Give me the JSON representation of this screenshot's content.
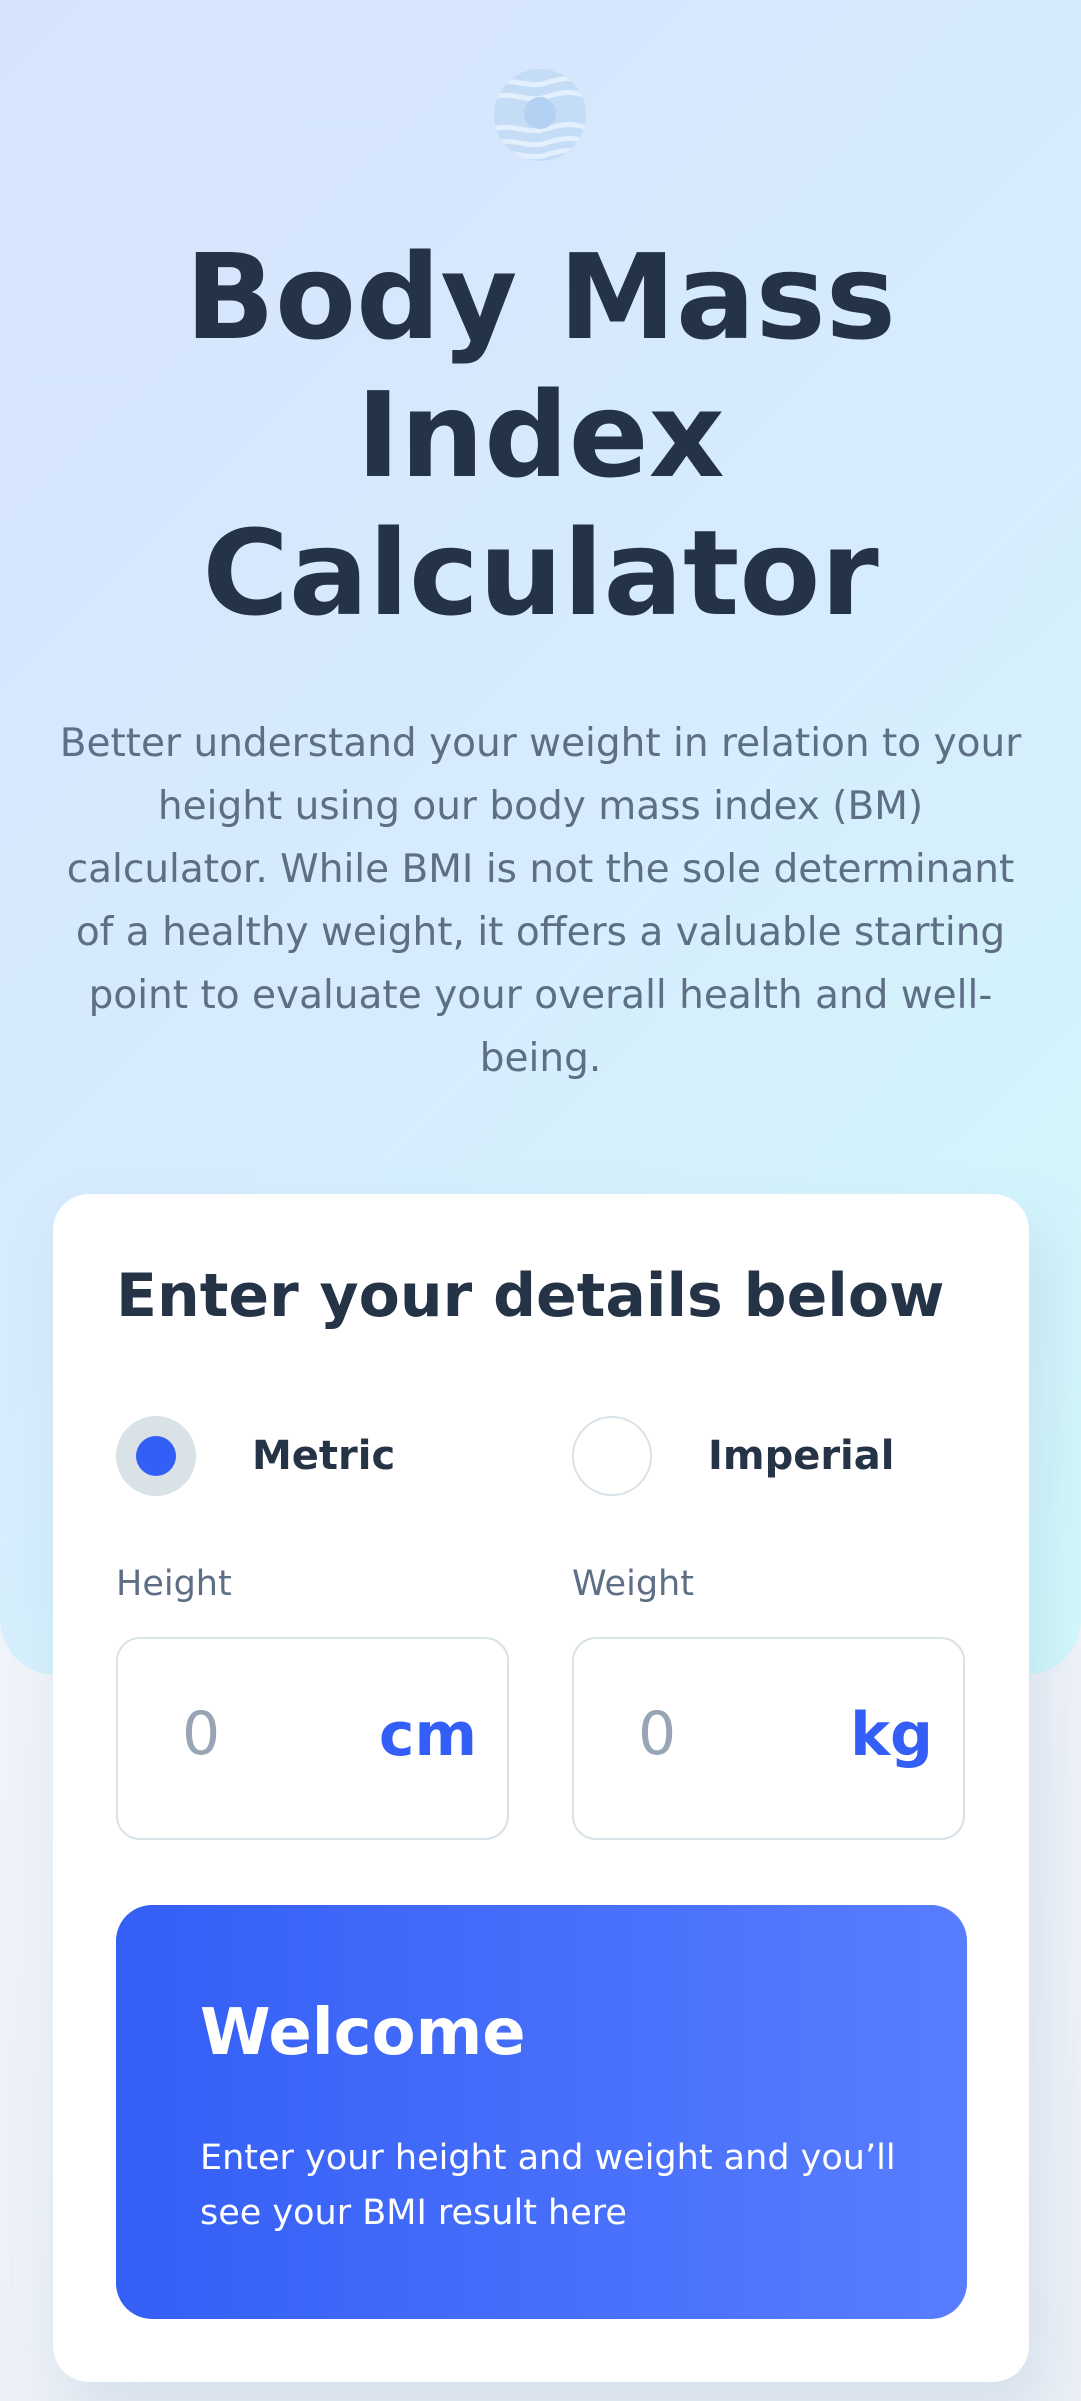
{
  "header": {
    "logo_icon": "bmi-logo-icon",
    "title_lines": [
      "Body Mass",
      "Index",
      "Calculator"
    ],
    "intro": "Better understand your weight in relation to your height using our body mass index (BM) calculator. While BMI is not the sole determinant of a healthy weight, it offers a valuable starting point to evaluate your overall health and well-being."
  },
  "form": {
    "heading": "Enter your details below",
    "units": {
      "selected": "metric",
      "metric_label": "Metric",
      "imperial_label": "Imperial"
    },
    "height": {
      "label": "Height",
      "placeholder": "0",
      "value": "",
      "unit": "cm"
    },
    "weight": {
      "label": "Weight",
      "placeholder": "0",
      "value": "",
      "unit": "kg"
    }
  },
  "result": {
    "title": "Welcome",
    "text": "Enter your height and weight and you’ll see your BMI result here"
  },
  "colors": {
    "accent": "#345ff6",
    "heading": "#253347",
    "body_text": "#5e6e85",
    "border": "#d8e2e7",
    "radio_checked_bg": "#d8e2e7",
    "placeholder": "#98a5b5"
  }
}
